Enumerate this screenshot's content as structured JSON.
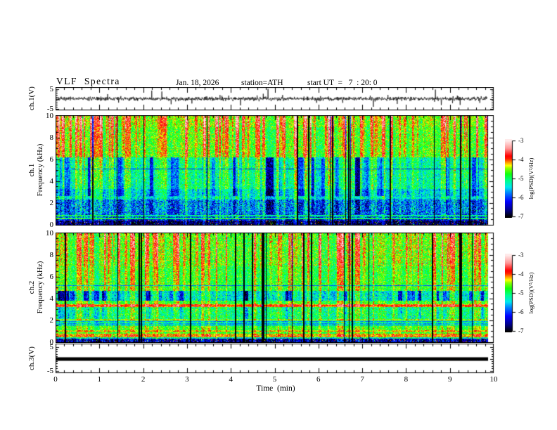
{
  "title": {
    "main": "VLF Spectra",
    "date": "Jan. 18, 2026",
    "station": "station=ATH",
    "start_ut": "start UT  =   7  : 20: 0"
  },
  "axes": {
    "time": {
      "label": "Time  (min)",
      "ticks": [
        "0",
        "1",
        "2",
        "3",
        "4",
        "5",
        "6",
        "7",
        "8",
        "9",
        "10"
      ],
      "minor_step_min": 0.2,
      "range_min": [
        0,
        10
      ]
    },
    "freq": {
      "label_ch1_line1": "ch.1",
      "label_ch2_line1": "ch.2",
      "label_line2": "Frequency  (kHz)",
      "ticks": [
        "10",
        "8",
        "6",
        "4",
        "2",
        "0"
      ],
      "minor_step_khz": 0.5,
      "range_khz": [
        0,
        10
      ]
    },
    "volt_ch1": {
      "label": "ch.1(V)",
      "ticks": [
        "5",
        "-5"
      ],
      "range_v": [
        -5,
        5
      ]
    },
    "volt_ch3": {
      "label": "ch.3(V)",
      "ticks": [
        "5",
        "-5"
      ],
      "range_v": [
        -5,
        5
      ]
    }
  },
  "colorbar": {
    "label": "log(PSD)(V²/Hz)",
    "ticks": [
      "-3",
      "-4",
      "-5",
      "-6",
      "-7"
    ],
    "range": [
      -7,
      -3
    ],
    "stops": [
      [
        -7.0,
        "#000000"
      ],
      [
        -6.65,
        "#000088"
      ],
      [
        -6.2,
        "#0000ff"
      ],
      [
        -5.75,
        "#0080ff"
      ],
      [
        -5.45,
        "#00e8f0"
      ],
      [
        -5.1,
        "#00ff90"
      ],
      [
        -4.75,
        "#10ff10"
      ],
      [
        -4.45,
        "#90ff00"
      ],
      [
        -4.3,
        "#ffff00"
      ],
      [
        -4.12,
        "#ff9000"
      ],
      [
        -3.95,
        "#ff2000"
      ],
      [
        -3.8,
        "#ff0000"
      ],
      [
        -3.4,
        "#ff9898"
      ],
      [
        -3.0,
        "#ffeaea"
      ]
    ]
  },
  "chart_data": [
    {
      "type": "line",
      "panel": "ch.1 voltage time series",
      "ylabel": "ch.1(V)",
      "ylim": [
        -5,
        5
      ],
      "x_range_min": [
        0,
        9.85
      ],
      "description": "broadband noise of about ±1 V with frequent impulsive spikes reaching ±5 V",
      "gen": {
        "seed": 7,
        "n": 1536,
        "sigma": 0.5,
        "spike_prob": 0.022,
        "spike_base": 1.3,
        "spike_scale": 1.2
      }
    },
    {
      "type": "heatmap",
      "panel": "ch.1 spectrogram",
      "ylabel": "ch.1 Frequency (kHz)",
      "ylim_khz": [
        0,
        10
      ],
      "zlim_logpsd": [
        -7,
        -3
      ],
      "x_range_min": [
        0,
        9.85
      ],
      "seed": 11,
      "bands": [
        [
          0,
          0.35,
          -6.85,
          0.3
        ],
        [
          0.35,
          0.55,
          -6.35,
          0.35
        ],
        [
          0.55,
          0.95,
          -6.1,
          0.4
        ],
        [
          0.95,
          2.3,
          -5.85,
          0.45
        ],
        [
          2.3,
          3.3,
          -5.5,
          0.3
        ],
        [
          3.3,
          6.2,
          -5.2,
          0.3
        ],
        [
          6.2,
          9.0,
          -4.7,
          0.28
        ],
        [
          9.0,
          10,
          -4.55,
          0.28
        ]
      ],
      "hlines": [
        [
          0.56,
          -5.05,
          2
        ],
        [
          0.78,
          -5.15,
          2
        ],
        [
          2.45,
          -5.25,
          1
        ],
        [
          5.15,
          -6.2,
          1
        ]
      ],
      "dips": [
        [
          2.6,
          6.2,
          1.0
        ],
        [
          0.95,
          2.3,
          0.5
        ]
      ],
      "salt_below_khz": 0.4,
      "salt_prob": 0.05,
      "streaks": {
        "bright_n": 110,
        "bright_min": 0.45,
        "bright_range": 1.25,
        "dark_n": 16,
        "dark_min": 2.2,
        "dark_range": 1.3
      },
      "profile": {
        "a": 0.35,
        "b": 0.65,
        "e": 1.3
      }
    },
    {
      "type": "heatmap",
      "panel": "ch.2 spectrogram",
      "ylabel": "ch.2 Frequency (kHz)",
      "ylim_khz": [
        0,
        10
      ],
      "zlim_logpsd": [
        -7,
        -3
      ],
      "x_range_min": [
        0,
        9.85
      ],
      "seed": 47,
      "bands": [
        [
          0,
          0.3,
          -6.55,
          0.35
        ],
        [
          0.3,
          0.45,
          -5.3,
          0.3
        ],
        [
          0.45,
          0.72,
          -4.2,
          0.28
        ],
        [
          0.72,
          0.95,
          -4.75,
          0.25
        ],
        [
          0.95,
          1.08,
          -4.35,
          0.2
        ],
        [
          1.08,
          1.45,
          -4.75,
          0.25
        ],
        [
          1.45,
          1.95,
          -5.15,
          0.3
        ],
        [
          1.95,
          2.12,
          -4.7,
          0.25
        ],
        [
          2.12,
          3.2,
          -5.0,
          0.32
        ],
        [
          3.2,
          3.5,
          -4.1,
          0.2
        ],
        [
          3.5,
          3.82,
          -4.8,
          0.25
        ],
        [
          3.82,
          4.7,
          -5.35,
          0.32
        ],
        [
          4.7,
          7.0,
          -4.8,
          0.27
        ],
        [
          7.0,
          10,
          -4.65,
          0.3
        ]
      ],
      "hlines": [
        [
          0.98,
          -4.2,
          1
        ],
        [
          1.55,
          -5.8,
          1
        ],
        [
          1.72,
          -5.75,
          1
        ],
        [
          1.88,
          -5.8,
          1
        ],
        [
          2.04,
          -4.35,
          1
        ],
        [
          3.35,
          -3.95,
          2
        ],
        [
          5.2,
          -5.9,
          1
        ]
      ],
      "dips": [
        [
          3.82,
          4.7,
          1.0
        ],
        [
          2.12,
          3.2,
          0.45
        ]
      ],
      "salt_below_khz": 0.3,
      "salt_prob": 0.06,
      "streaks": {
        "bright_n": 95,
        "bright_min": 0.4,
        "bright_range": 1.15,
        "dark_n": 22,
        "dark_min": 2.4,
        "dark_range": 1.2
      },
      "profile": {
        "a": 0.3,
        "b": 0.7,
        "e": 1.2
      }
    },
    {
      "type": "line",
      "panel": "ch.3 voltage time series",
      "ylabel": "ch.3(V)",
      "ylim": [
        -5,
        5
      ],
      "x_range_min": [
        0,
        9.85
      ],
      "constant_value": 0,
      "description": "flat thick line at 0 V (no signal on channel 3)"
    }
  ]
}
